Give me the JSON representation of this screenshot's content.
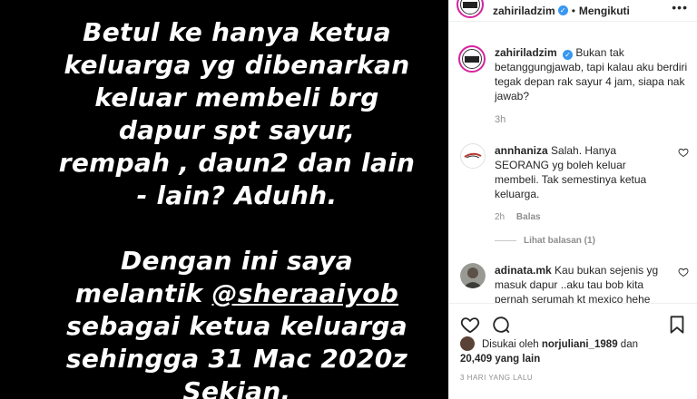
{
  "post": {
    "lines_para1": [
      "Betul ke hanya ketua",
      "keluarga yg dibenarkan",
      "keluar membeli brg",
      "dapur spt sayur,",
      "rempah , daun2 dan lain",
      "- lain? Aduhh."
    ],
    "para2_line1": "Dengan ini saya",
    "para2_line2_prefix": "melantik ",
    "para2_mention": "@sheraaiyob",
    "para2_line3": "sebagai ketua keluarga",
    "para2_line4": "sehingga 31 Mac 2020z",
    "para2_line5": "Sekian."
  },
  "header": {
    "username": "zahiriladzim",
    "separator": "•",
    "follow_state": "Mengikuti",
    "more_icon": "more-horizontal-icon"
  },
  "caption": {
    "username": "zahiriladzim",
    "text": "Bukan tak betanggungjawab, tapi kalau aku berdiri tegak depan rak sayur 4 jam, siapa nak jawab?",
    "time": "3h"
  },
  "comments": [
    {
      "username": "annhaniza",
      "text": "Salah. Hanya SEORANG yg boleh keluar membeli. Tak semestinya ketua keluarga.",
      "time": "2h",
      "reply_label": "Balas"
    },
    {
      "username": "adinata.mk",
      "text": "Kau bukan sejenis yg masuk dapur ..aku tau bob kita pernah serumah kt mexico hehe"
    }
  ],
  "view_replies": "Lihat balasan (1)",
  "likes": {
    "prefix": "Disukai oleh",
    "liked_user": "norjuliani_1989",
    "conj": "dan",
    "count": "20,409 yang lain"
  },
  "timestamp": "3 HARI YANG LALU",
  "colors": {
    "verified": "#3897f0",
    "muted": "#8e8e8e",
    "text": "#262626",
    "story_bg": "#000000"
  }
}
